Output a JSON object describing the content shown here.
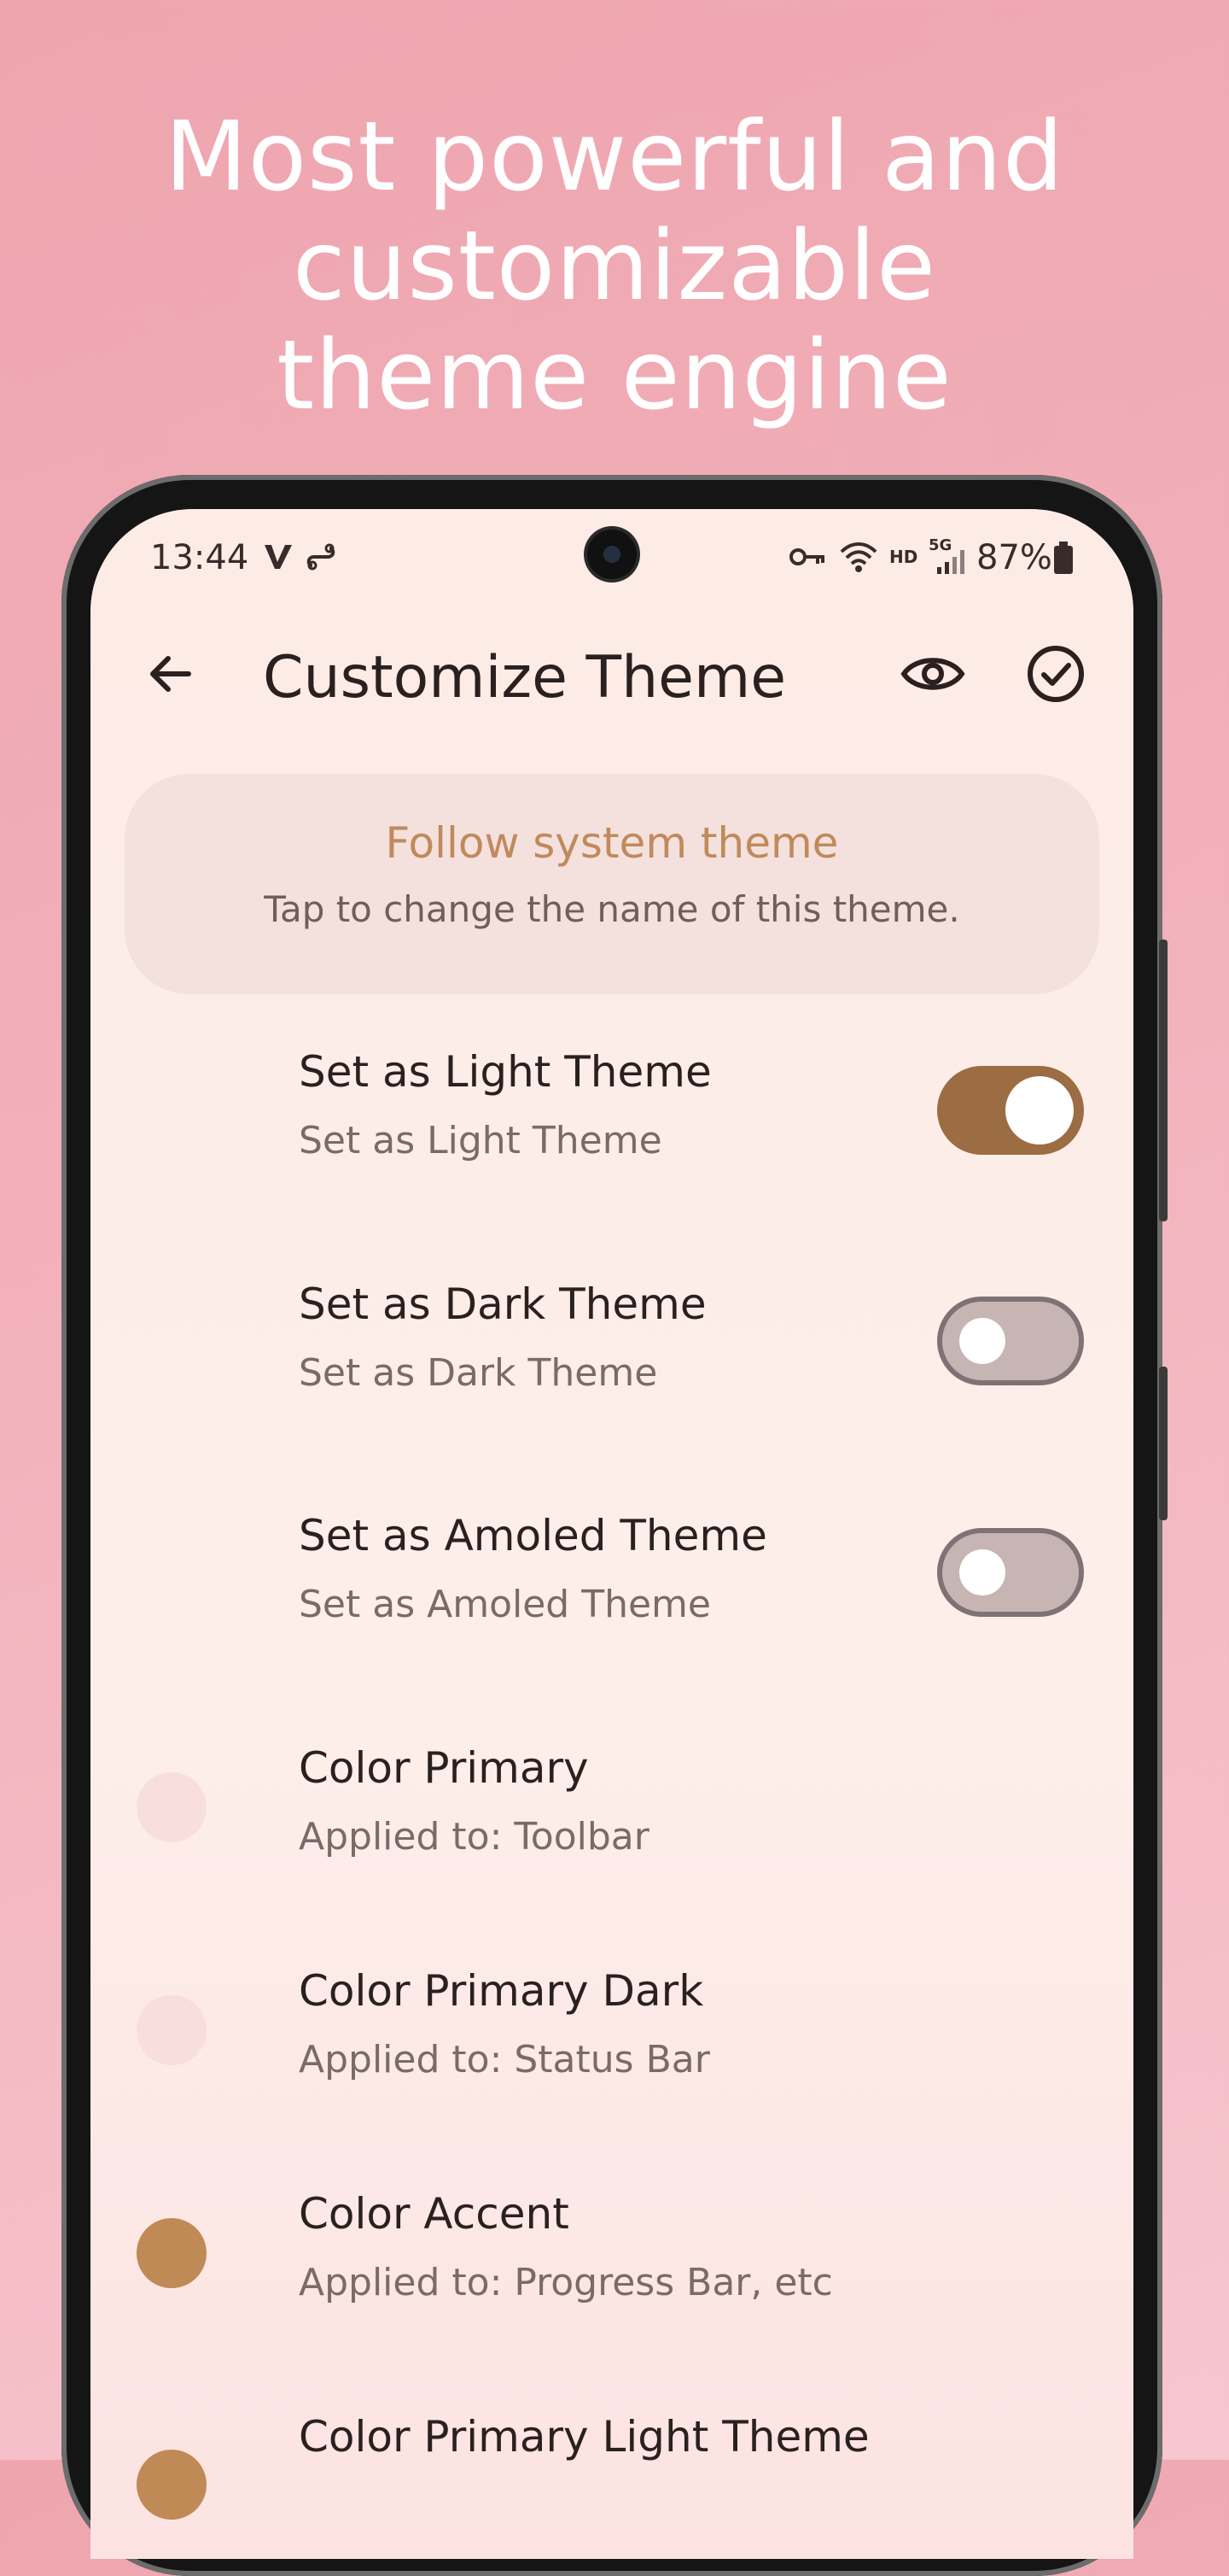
{
  "headline": {
    "line1": "Most powerful and",
    "line2": "customizable",
    "line3": "theme engine"
  },
  "status_bar": {
    "time": "13:44",
    "battery": "87%",
    "network_label_hd": "HD",
    "network_label_5g": "5G",
    "icons": [
      "v-notification-icon",
      "link-icon",
      "vpn-key-icon",
      "wifi-icon",
      "signal-icon",
      "battery-icon"
    ]
  },
  "toolbar": {
    "title": "Customize Theme",
    "back_icon": "arrow-back-icon",
    "preview_icon": "eye-icon",
    "save_icon": "check-circle-icon"
  },
  "name_card": {
    "title": "Follow system theme",
    "subtitle": "Tap to change the name of this theme."
  },
  "toggles": [
    {
      "title": "Set as Light Theme",
      "subtitle": "Set as Light Theme",
      "checked": true
    },
    {
      "title": "Set as Dark Theme",
      "subtitle": "Set as Dark Theme",
      "checked": false
    },
    {
      "title": "Set as Amoled Theme",
      "subtitle": "Set as Amoled Theme",
      "checked": false
    }
  ],
  "colors": [
    {
      "title": "Color Primary",
      "subtitle": "Applied to: Toolbar",
      "swatch": "#f8dedd"
    },
    {
      "title": "Color Primary Dark",
      "subtitle": "Applied to: Status Bar",
      "swatch": "#f8dedd"
    },
    {
      "title": "Color Accent",
      "subtitle": "Applied to: Progress Bar, etc",
      "swatch": "#c08a56"
    },
    {
      "title": "Color Primary Light Theme",
      "subtitle": "",
      "swatch": "#c08a56"
    }
  ],
  "palette": {
    "accent": "#9c6c42",
    "card_title": "#c08a5c",
    "background": "#fdece6"
  }
}
